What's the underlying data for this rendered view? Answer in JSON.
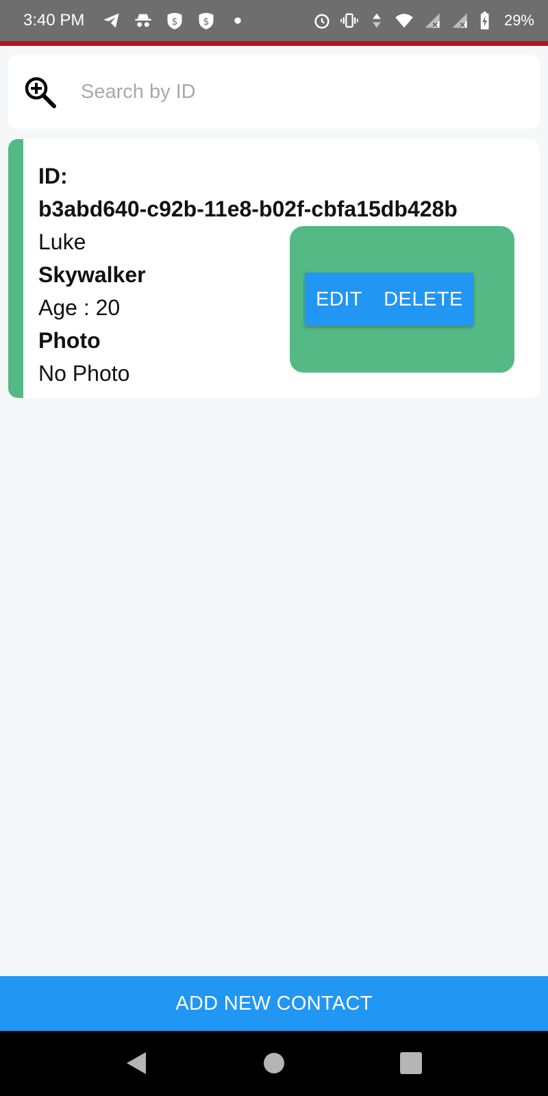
{
  "status_bar": {
    "time": "3:40 PM",
    "battery": "29%",
    "icons_left": [
      "telegram-icon",
      "incognito-icon",
      "dollar-shield-icon",
      "dollar-shield-icon",
      "dot-icon"
    ],
    "icons_right": [
      "alarm-icon",
      "vibrate-icon",
      "data-arrows-icon",
      "wifi-icon",
      "signal-x-icon",
      "signal-x-icon",
      "battery-charging-icon"
    ],
    "accent_color": "#b5121b"
  },
  "search": {
    "placeholder": "Search by ID",
    "value": "",
    "icon": "zoom-in-icon"
  },
  "contact": {
    "id_label": "ID:",
    "id_value": "b3abd640-c92b-11e8-b02f-cbfa15db428b",
    "first_name": "Luke",
    "last_name": "Skywalker",
    "age": "Age : 20",
    "photo_label": "Photo",
    "photo_value": "No Photo",
    "edit_label": "EDIT",
    "delete_label": "DELETE"
  },
  "footer": {
    "add_label": "ADD NEW CONTACT"
  },
  "colors": {
    "accent_green": "#55b986",
    "primary_blue": "#2196f3",
    "background": "#f6f7f9"
  }
}
